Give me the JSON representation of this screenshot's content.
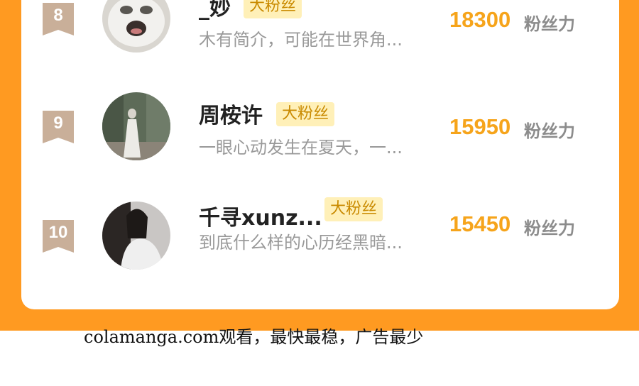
{
  "rows": [
    {
      "rank": "8",
      "name": "_妙",
      "badge": "大粉丝",
      "intro": "木有简介，可能在世界角...",
      "fans": "18300",
      "unit": "粉丝力"
    },
    {
      "rank": "9",
      "name": "周桉许",
      "badge": "大粉丝",
      "intro": "一眼心动发生在夏天，一...",
      "fans": "15950",
      "unit": "粉丝力"
    },
    {
      "rank": "10",
      "name": "千寻xunz...",
      "badge": "大粉丝",
      "intro": "到底什么样的心历经黑暗...",
      "fans": "15450",
      "unit": "粉丝力"
    }
  ],
  "footer": {
    "text": "colamanga.com观看，最快最稳，广告最少"
  },
  "colors": {
    "orange": "#FF9A21",
    "rank_badge": "#C9AF99",
    "fans_value": "#F6A41B",
    "fan_badge_bg": "#FFF0B8"
  }
}
